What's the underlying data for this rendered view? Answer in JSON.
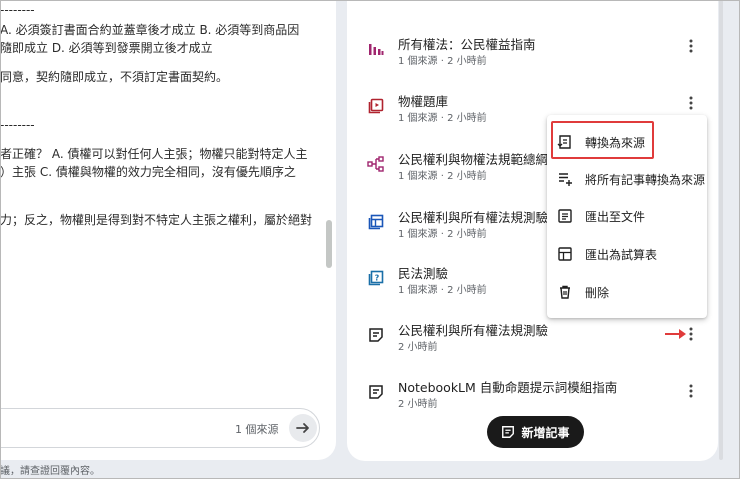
{
  "chat": {
    "lines": [
      "--------",
      "A. 必須簽訂書面合約並蓋章後才成立 B. 必須等到商品因",
      "隨即成立 D. 必須等到發票開立後才成立",
      "同意，契約隨即成立，不須訂定書面契約。",
      "--------",
      "者正確？ A. 債權可以對任何人主張；物權只能對特定人主",
      "）主張 C. 債權與物權的效力完全相同，沒有優先順序之",
      "力；反之，物權則是得到對不特定人主張之權利，屬於絕對"
    ],
    "source_count": "1 個來源",
    "disclaimer": "議，請查證回覆內容。"
  },
  "notes": [
    {
      "title": "所有權法：公民權益指南",
      "meta": "1 個來源 · 2 小時前",
      "icon": "bar-chart-icon",
      "color": "#a0256e"
    },
    {
      "title": "物權題庫",
      "meta": "1 個來源 · 2 小時前",
      "icon": "quiz-card-icon",
      "color": "#b0232f"
    },
    {
      "title": "公民權利與物權法規範總綱",
      "meta": "1 個來源 · 2 小時前",
      "icon": "mind-map-icon",
      "color": "#a0256e"
    },
    {
      "title": "公民權利與所有權法規測驗題庫",
      "meta": "1 個來源 · 2 小時前",
      "icon": "table-icon",
      "color": "#1a56b8"
    },
    {
      "title": "民法測驗",
      "meta": "1 個來源 · 2 小時前",
      "icon": "quiz-icon",
      "color": "#1a6fa8"
    },
    {
      "title": "公民權利與所有權法規測驗",
      "meta": "2 小時前",
      "icon": "note-icon",
      "color": "#1f1f1f"
    },
    {
      "title": "NotebookLM 自動命題提示詞模組指南",
      "meta": "2 小時前",
      "icon": "note-icon",
      "color": "#1f1f1f"
    }
  ],
  "menu": {
    "items": [
      {
        "label": "轉換為來源",
        "icon": "convert-source-icon"
      },
      {
        "label": "將所有記事轉換為來源",
        "icon": "convert-all-icon"
      },
      {
        "label": "匯出至文件",
        "icon": "export-doc-icon"
      },
      {
        "label": "匯出為試算表",
        "icon": "export-sheet-icon"
      },
      {
        "label": "刪除",
        "icon": "trash-icon"
      }
    ]
  },
  "add_note_label": "新增記事",
  "colors": {
    "highlight": "#e03b3b",
    "button_bg": "#1a1a1a"
  }
}
